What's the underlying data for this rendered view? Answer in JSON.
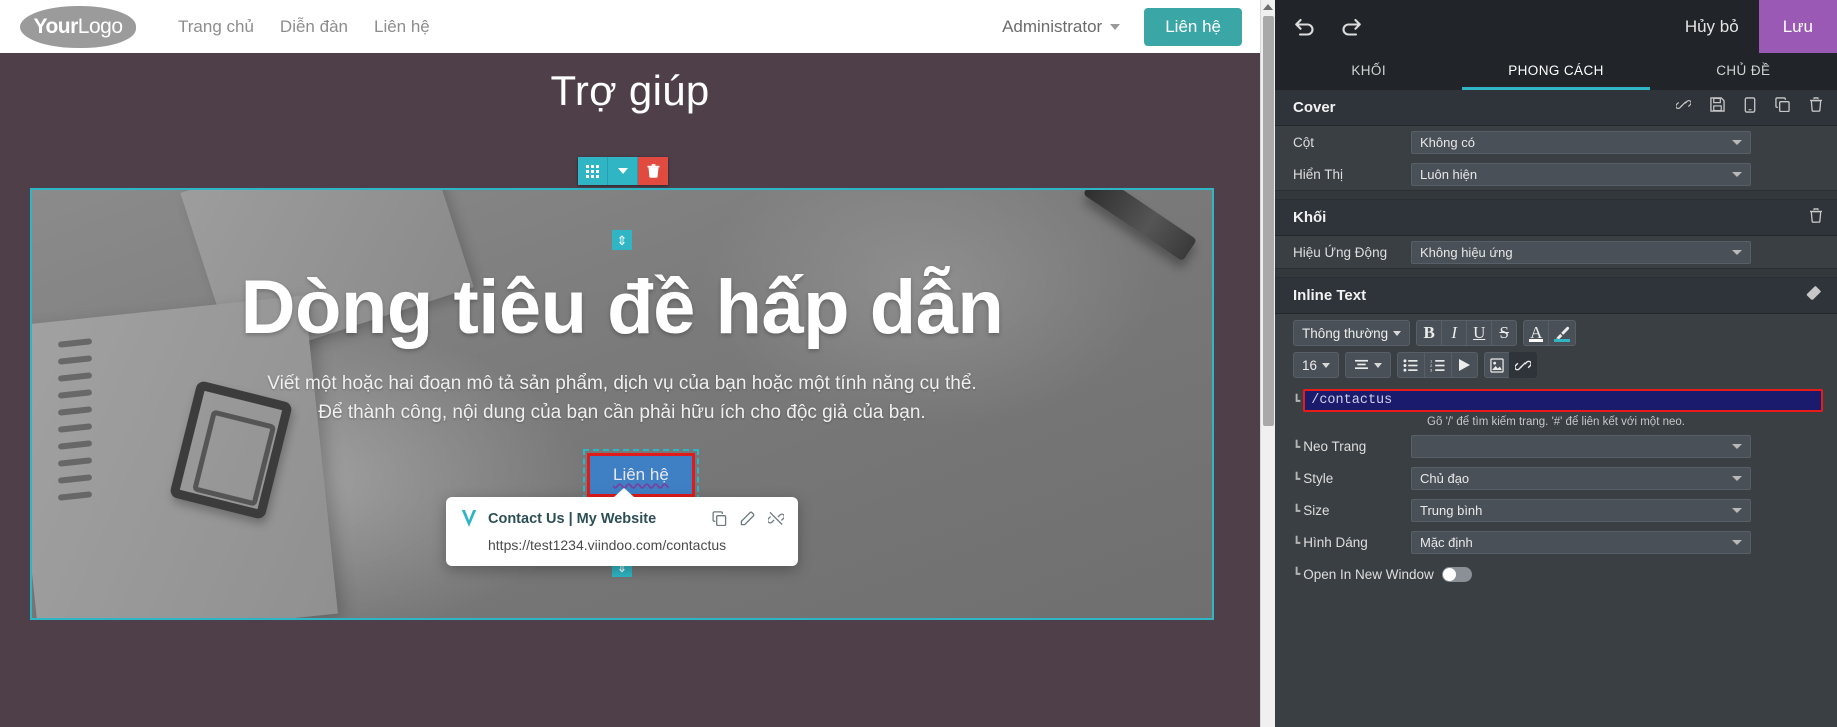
{
  "site": {
    "logo_text_bold": "Your",
    "logo_text_light": "Logo",
    "nav": [
      {
        "label": "Trang chủ"
      },
      {
        "label": "Diễn đàn"
      },
      {
        "label": "Liên hệ"
      }
    ],
    "admin_label": "Administrator",
    "header_cta": "Liên hệ",
    "page_title": "Trợ giúp",
    "hero_heading": "Dòng tiêu đề hấp dẫn",
    "hero_paragraph_line1": "Viết một hoặc hai đoạn mô tả sản phẩm, dịch vụ của bạn hoặc một tính năng cụ thể.",
    "hero_paragraph_line2": "Để thành công, nội dung của bạn cần phải hữu ích cho độc giả của bạn.",
    "hero_button": "Liên hệ"
  },
  "link_popover": {
    "title": "Contact Us | My Website",
    "url": "https://test1234.viindoo.com/contactus",
    "actions": [
      {
        "name": "copy-link-icon"
      },
      {
        "name": "edit-link-icon"
      },
      {
        "name": "unlink-icon"
      }
    ]
  },
  "panel": {
    "undo_icon": "undo-icon",
    "redo_icon": "redo-icon",
    "cancel_label": "Hủy bỏ",
    "save_label": "Lưu",
    "tabs": [
      {
        "label": "KHỐI",
        "active": false
      },
      {
        "label": "PHONG CÁCH",
        "active": true
      },
      {
        "label": "CHỦ ĐỀ",
        "active": false
      }
    ],
    "cover_section": {
      "title": "Cover",
      "tools": [
        "link-icon",
        "save-icon",
        "mobile-icon",
        "duplicate-icon",
        "trash-icon"
      ],
      "rows": [
        {
          "label": "Cột",
          "value": "Không có"
        },
        {
          "label": "Hiển Thị",
          "value": "Luôn hiện"
        }
      ]
    },
    "block_section": {
      "title": "Khối",
      "tools": [
        "trash-icon"
      ],
      "rows": [
        {
          "label": "Hiệu Ứng Động",
          "value": "Không hiệu ứng"
        }
      ]
    },
    "inline_text_section": {
      "title": "Inline Text",
      "tools": [
        "eraser-icon"
      ],
      "toolbar_row1": [
        {
          "name": "paragraph-style-select",
          "label": "Thông thường",
          "type": "dropdown"
        },
        {
          "name": "bold-button",
          "label": "B",
          "type": "serif"
        },
        {
          "name": "italic-button",
          "label": "I",
          "type": "serif-italic"
        },
        {
          "name": "underline-button",
          "label": "U",
          "type": "serif-underline"
        },
        {
          "name": "strikethrough-button",
          "label": "S",
          "type": "serif-strike"
        },
        {
          "name": "font-color-button",
          "label": "A",
          "type": "color-white"
        },
        {
          "name": "background-color-button",
          "label": "brush-icon",
          "type": "color-teal"
        }
      ],
      "toolbar_row2": [
        {
          "name": "font-size-select",
          "label": "16",
          "type": "dropdown"
        },
        {
          "name": "align-select",
          "label": "align-icon",
          "type": "dropdown-icon"
        },
        {
          "name": "unordered-list-button",
          "label": "bullet-list-icon"
        },
        {
          "name": "ordered-list-button",
          "label": "numbered-list-icon"
        },
        {
          "name": "media-button",
          "label": "play-icon"
        },
        {
          "name": "image-button",
          "label": "image-icon"
        },
        {
          "name": "link-button",
          "label": "link-icon",
          "active": true
        }
      ],
      "url_value": "/contactus",
      "url_hint": "Gõ '/' để tìm kiếm trang. '#' để liên kết với một neo.",
      "rows": [
        {
          "label": "Neo Trang",
          "value": ""
        },
        {
          "label": "Style",
          "value": "Chủ đạo"
        },
        {
          "label": "Size",
          "value": "Trung bình"
        },
        {
          "label": "Hình Dáng",
          "value": "Mặc định"
        }
      ],
      "toggle_label": "Open In New Window",
      "toggle_on": false
    }
  },
  "colors": {
    "accent_teal": "#2fb5c4",
    "save_purple": "#9b59b6",
    "panel_bg": "#3a3f44",
    "panel_dark": "#212529",
    "selection_red": "#e81b1b",
    "site_teal": "#3aa6a6"
  }
}
